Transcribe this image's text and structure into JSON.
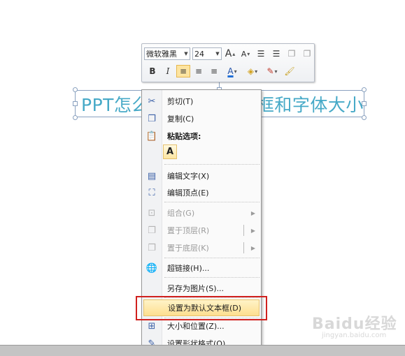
{
  "mini_toolbar": {
    "font_name": "微软雅黑",
    "font_size": "24",
    "grow_font": "A",
    "shrink_font": "A",
    "bold": "B",
    "italic": "I",
    "font_color_letter": "A"
  },
  "textbox": {
    "text": "PPT怎么设置默认文本框和字体大小"
  },
  "context_menu": {
    "items": [
      {
        "label": "剪切(T)",
        "icon": "scissors-icon"
      },
      {
        "label": "复制(C)",
        "icon": "copy-icon"
      },
      {
        "label": "粘贴选项:",
        "icon": "clipboard-icon"
      },
      {
        "label": "编辑文字(X)",
        "icon": "edit-text-icon"
      },
      {
        "label": "编辑顶点(E)",
        "icon": "edit-points-icon"
      },
      {
        "label": "组合(G)",
        "icon": "group-icon",
        "disabled": true
      },
      {
        "label": "置于顶层(R)",
        "icon": "bring-to-front-icon",
        "disabled": true
      },
      {
        "label": "置于底层(K)",
        "icon": "send-to-back-icon",
        "disabled": true
      },
      {
        "label": "超链接(H)...",
        "icon": "hyperlink-icon"
      },
      {
        "label": "另存为图片(S)...",
        "icon": ""
      },
      {
        "label": "设置为默认文本框(D)",
        "icon": "",
        "highlighted": true
      },
      {
        "label": "大小和位置(Z)...",
        "icon": "size-position-icon"
      },
      {
        "label": "设置形状格式(O)...",
        "icon": "format-shape-icon"
      }
    ],
    "paste_option_letter": "A"
  },
  "watermark": {
    "text": "Baidu经验",
    "sub": "jingyan.baidu.com"
  },
  "colors": {
    "textbox_text": "#46a9c7",
    "highlight_border": "#d0201e",
    "menu_highlight": "#fddf8f"
  }
}
